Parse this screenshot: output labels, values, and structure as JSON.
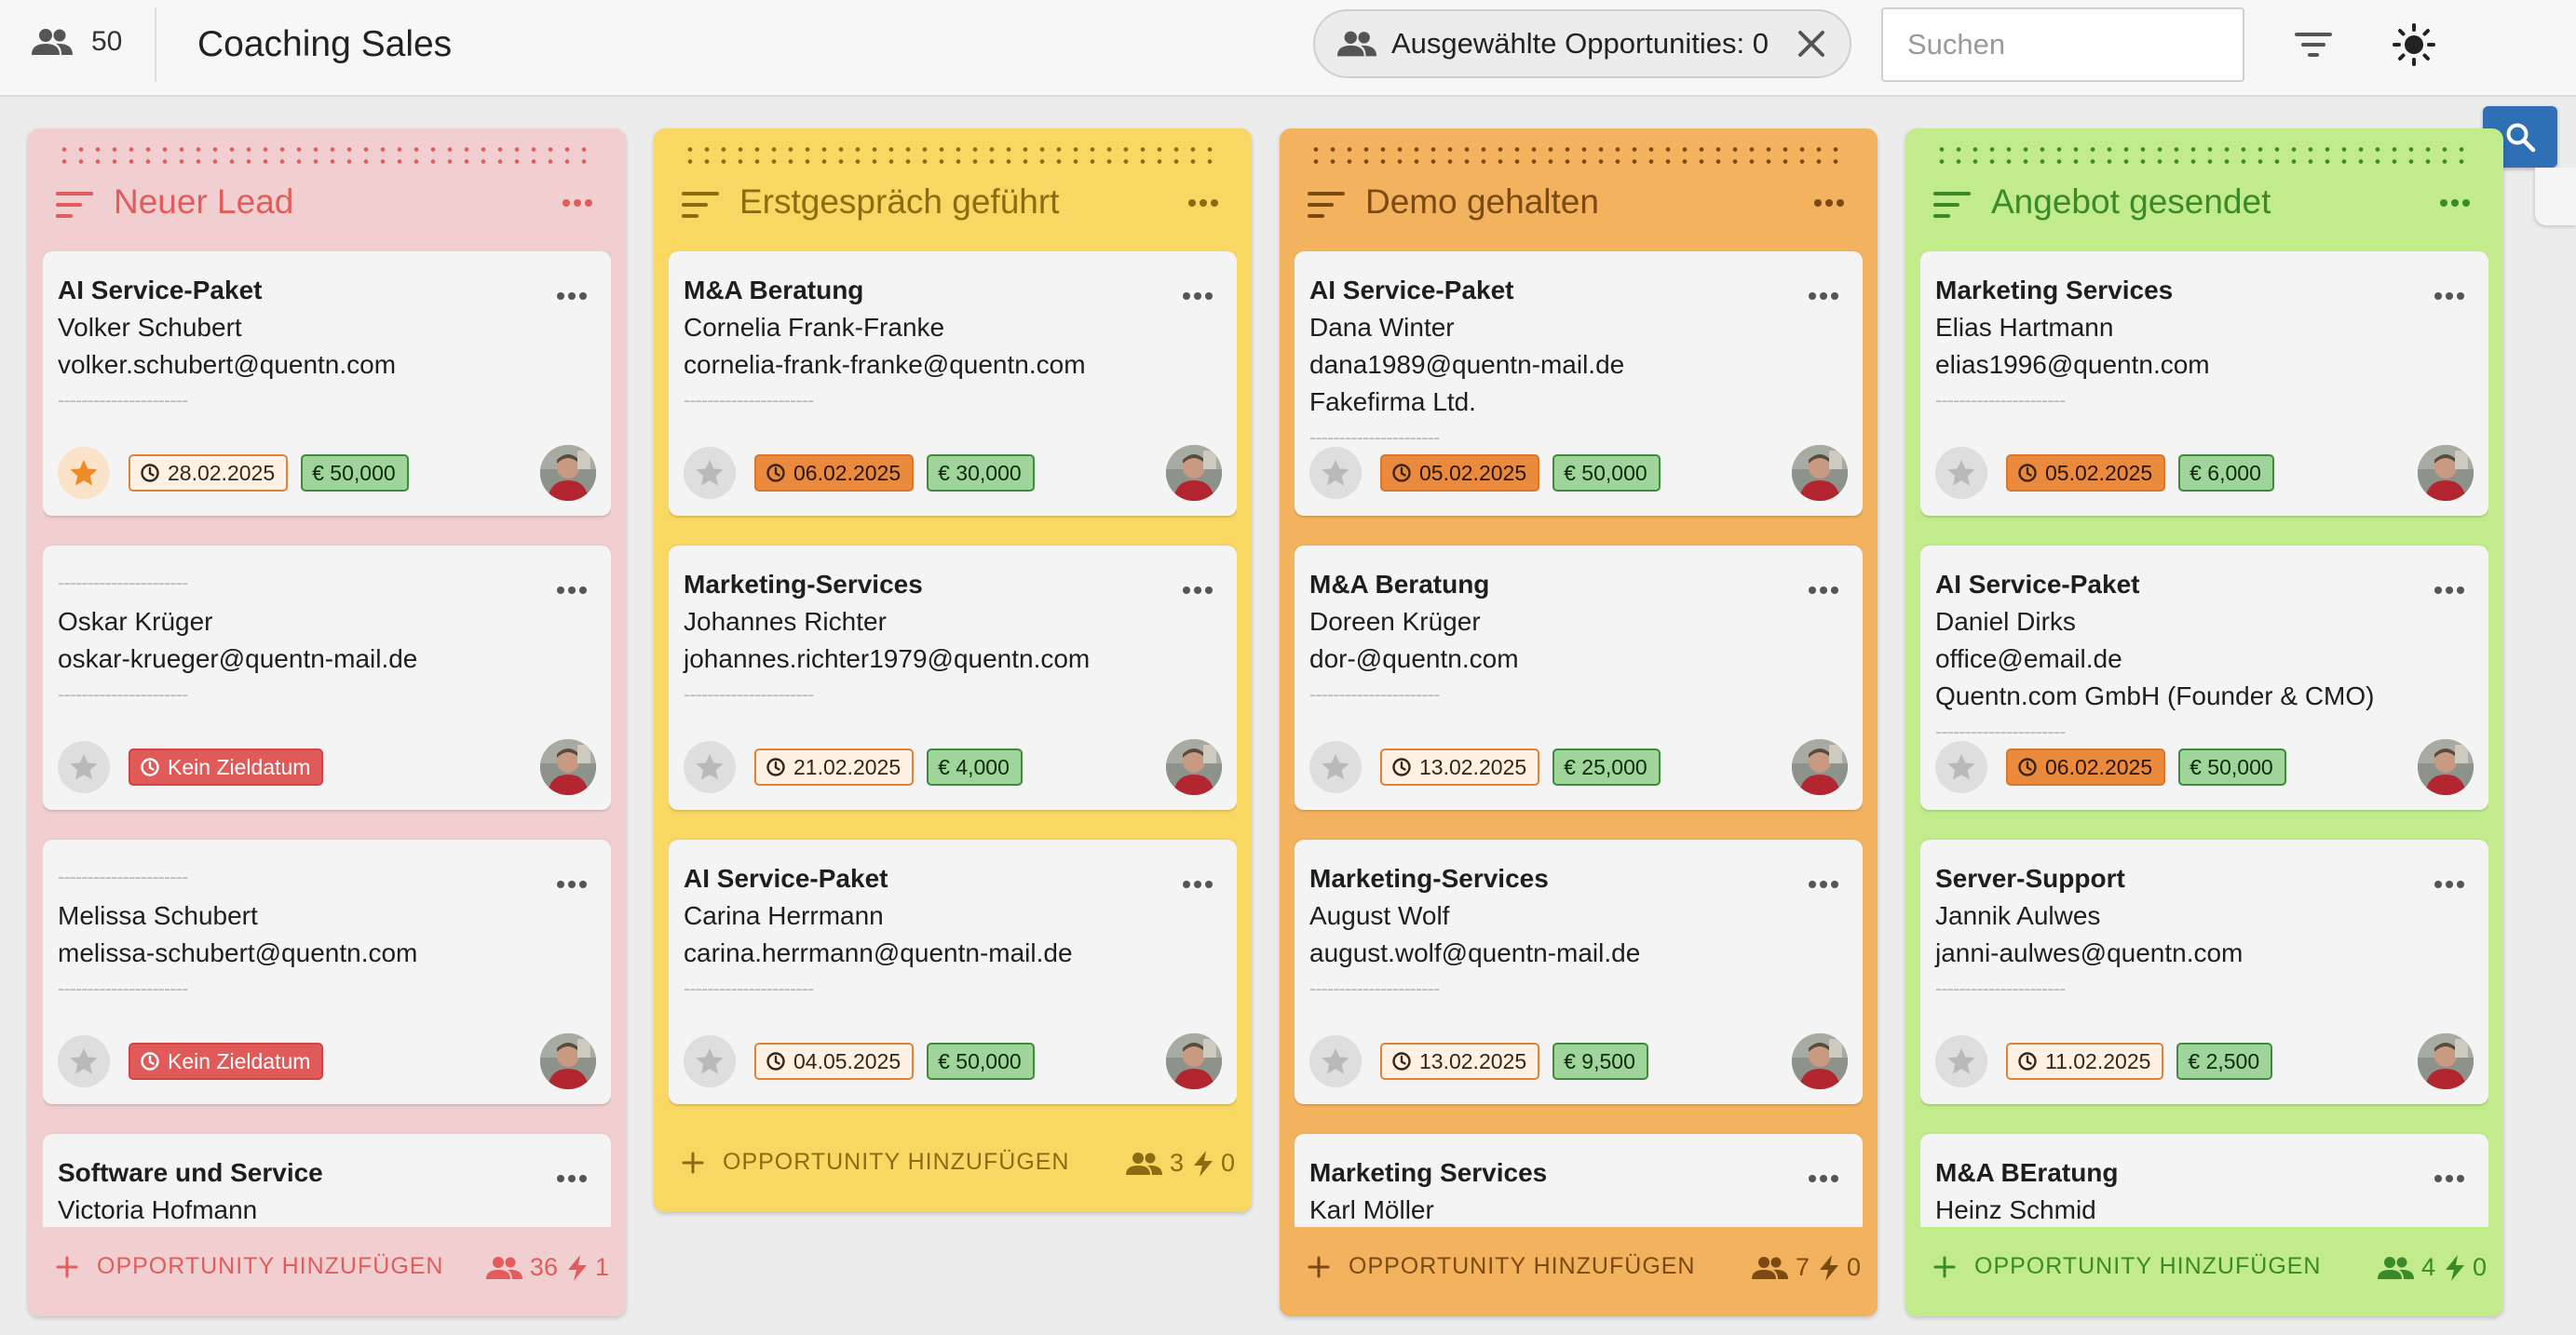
{
  "header": {
    "user_count": "50",
    "title": "Coaching Sales",
    "selected_label": "Ausgewählte Opportunities: 0",
    "search_placeholder": "Suchen"
  },
  "icons": {
    "users": "group-icon",
    "close": "close-icon",
    "filter": "filter-icon",
    "theme": "sun-icon",
    "search": "magnifier-icon",
    "star": "star-icon",
    "clock": "clock-icon",
    "bolt": "bolt-icon",
    "plus": "plus-icon",
    "more": "more-horizontal-icon",
    "sort": "sort-lines-icon"
  },
  "columns": [
    {
      "title": "Neuer Lead",
      "color": "#f1cfd0",
      "accent": "#e35c5c",
      "add_label": "OPPORTUNITY HINZUFÜGEN",
      "people_count": "36",
      "bolt_count": "1",
      "cards": [
        {
          "lines": [
            "AI Service-Paket",
            "Volker Schubert",
            "volker.schubert@quentn.com"
          ],
          "starred": true,
          "date": "28.02.2025",
          "date_style": "outline",
          "amount": "€ 50,000"
        },
        {
          "lines": [
            "",
            "Oskar Krüger",
            "oskar-krueger@quentn-mail.de"
          ],
          "starred": false,
          "date": "Kein Zieldatum",
          "date_style": "nodate",
          "amount": ""
        },
        {
          "lines": [
            "",
            "Melissa Schubert",
            "melissa-schubert@quentn.com"
          ],
          "starred": false,
          "date": "Kein Zieldatum",
          "date_style": "nodate",
          "amount": ""
        },
        {
          "lines": [
            "Software und Service",
            "Victoria Hofmann"
          ],
          "starred": false,
          "date": "",
          "date_style": "outline",
          "amount": ""
        }
      ]
    },
    {
      "title": "Erstgespräch geführt",
      "color": "#f8d763",
      "accent": "#8b6c12",
      "add_label": "OPPORTUNITY HINZUFÜGEN",
      "people_count": "3",
      "bolt_count": "0",
      "cards": [
        {
          "lines": [
            "M&A Beratung",
            "Cornelia Frank-Franke",
            "cornelia-frank-franke@quentn.com"
          ],
          "starred": false,
          "date": "06.02.2025",
          "date_style": "filled",
          "amount": "€ 30,000"
        },
        {
          "lines": [
            "Marketing-Services",
            "Johannes Richter",
            "johannes.richter1979@quentn.com"
          ],
          "starred": false,
          "date": "21.02.2025",
          "date_style": "outline",
          "amount": "€ 4,000"
        },
        {
          "lines": [
            "AI Service-Paket",
            "Carina Herrmann",
            "carina.herrmann@quentn-mail.de"
          ],
          "starred": false,
          "date": "04.05.2025",
          "date_style": "outline",
          "amount": "€ 50,000"
        }
      ]
    },
    {
      "title": "Demo gehalten",
      "color": "#f3b25e",
      "accent": "#7a4a12",
      "add_label": "OPPORTUNITY HINZUFÜGEN",
      "people_count": "7",
      "bolt_count": "0",
      "cards": [
        {
          "lines": [
            "AI Service-Paket",
            "Dana Winter",
            "dana1989@quentn-mail.de",
            "Fakefirma Ltd."
          ],
          "starred": false,
          "date": "05.02.2025",
          "date_style": "filled",
          "amount": "€ 50,000"
        },
        {
          "lines": [
            "M&A Beratung",
            "Doreen Krüger",
            "dor-@quentn.com"
          ],
          "starred": false,
          "date": "13.02.2025",
          "date_style": "outline",
          "amount": "€ 25,000"
        },
        {
          "lines": [
            "Marketing-Services",
            "August Wolf",
            "august.wolf@quentn-mail.de"
          ],
          "starred": false,
          "date": "13.02.2025",
          "date_style": "outline",
          "amount": "€ 9,500"
        },
        {
          "lines": [
            "Marketing Services",
            "Karl Möller"
          ],
          "starred": false,
          "date": "",
          "date_style": "outline",
          "amount": ""
        }
      ]
    },
    {
      "title": "Angebot gesendet",
      "color": "#c2ec8c",
      "accent": "#3a8a2a",
      "add_label": "OPPORTUNITY HINZUFÜGEN",
      "people_count": "4",
      "bolt_count": "0",
      "cards": [
        {
          "lines": [
            "Marketing Services",
            "Elias Hartmann",
            "elias1996@quentn.com"
          ],
          "starred": false,
          "date": "05.02.2025",
          "date_style": "filled",
          "amount": "€ 6,000"
        },
        {
          "lines": [
            "AI Service-Paket",
            "Daniel Dirks",
            "office@email.de",
            "Quentn.com GmbH (Founder & CMO)"
          ],
          "starred": false,
          "date": "06.02.2025",
          "date_style": "filled",
          "amount": "€ 50,000"
        },
        {
          "lines": [
            "Server-Support",
            "Jannik Aulwes",
            "janni-aulwes@quentn.com"
          ],
          "starred": false,
          "date": "11.02.2025",
          "date_style": "outline",
          "amount": "€ 2,500"
        },
        {
          "lines": [
            "M&A BEratung",
            "Heinz Schmid"
          ],
          "starred": false,
          "date": "",
          "date_style": "outline",
          "amount": ""
        }
      ]
    }
  ]
}
